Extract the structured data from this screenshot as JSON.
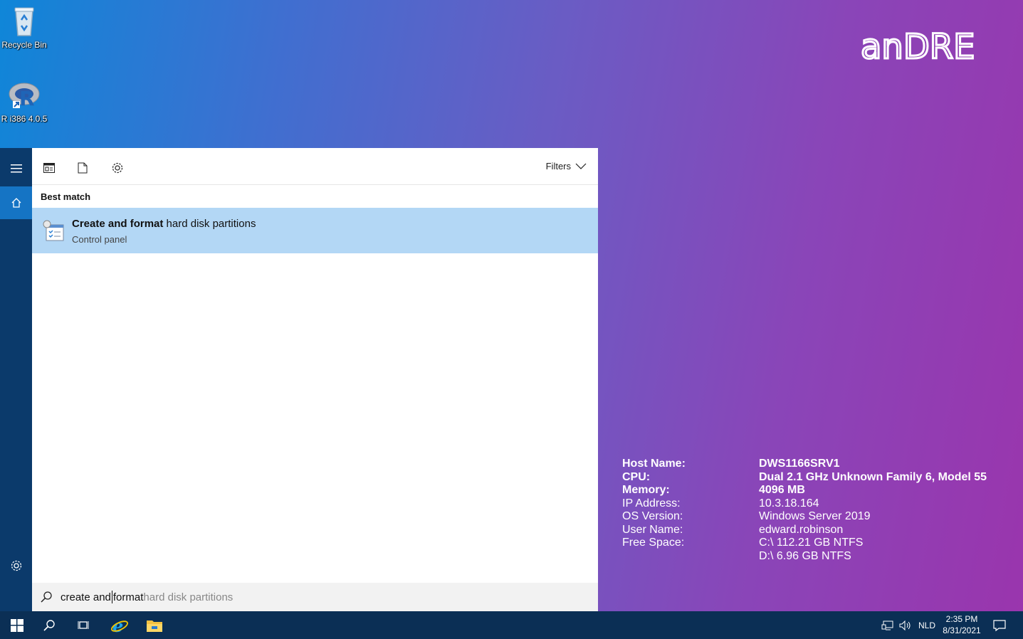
{
  "desktop": {
    "icons": [
      {
        "label": "Recycle Bin",
        "icon": "recycle-bin-icon"
      },
      {
        "label": "R i386 4.0.5",
        "icon": "r-app-icon"
      }
    ],
    "brand_text": "anDRE"
  },
  "sysinfo": {
    "rows": [
      {
        "key": "Host Name:",
        "value": "DWS1166SRV1",
        "bold": true
      },
      {
        "key": "CPU:",
        "value": "Dual 2.1 GHz Unknown Family 6, Model 55",
        "bold": true
      },
      {
        "key": "Memory:",
        "value": "4096 MB",
        "bold": true
      },
      {
        "key": "IP Address:",
        "value": "10.3.18.164",
        "bold": false
      },
      {
        "key": "OS Version:",
        "value": "Windows Server 2019",
        "bold": false
      },
      {
        "key": "User Name:",
        "value": "edward.robinson",
        "bold": false
      },
      {
        "key": "Free Space:",
        "value": "C:\\ 112.21 GB NTFS",
        "bold": false
      },
      {
        "key": "",
        "value": "D:\\ 6.96 GB NTFS",
        "bold": false
      }
    ]
  },
  "search": {
    "filters_label": "Filters",
    "section_title": "Best match",
    "result": {
      "title_bold": "Create and format",
      "title_rest": " hard disk partitions",
      "subtitle": "Control panel"
    },
    "query_typed_before_caret": "create and",
    "query_typed_after_caret": "format",
    "query_suggestion": " hard disk partitions"
  },
  "taskbar": {
    "language": "NLD",
    "time": "2:35 PM",
    "date": "8/31/2021"
  },
  "colors": {
    "taskbar": "#0b2f55",
    "rail": "#0b3a6b",
    "rail_active": "#1574c4",
    "result_highlight": "#b3d7f5"
  }
}
